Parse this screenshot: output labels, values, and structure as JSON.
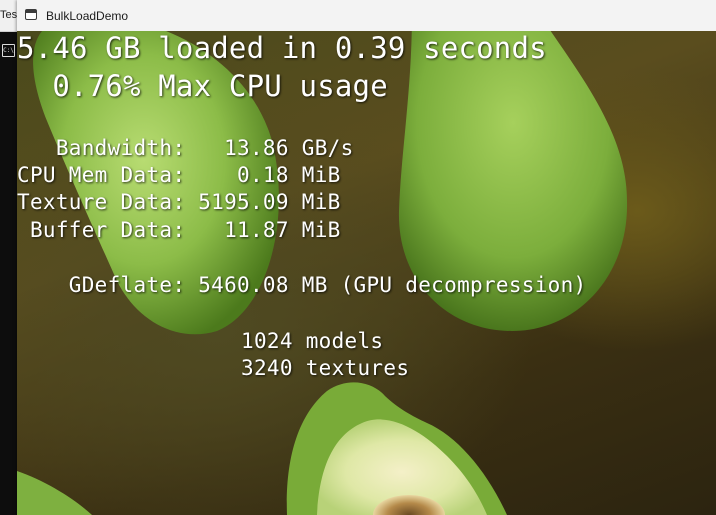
{
  "background_window": {
    "title_fragment": "Tes",
    "icon_name": "console-icon"
  },
  "window": {
    "title": "BulkLoadDemo",
    "icon_name": "app-window-icon"
  },
  "stats": {
    "headline_line1": "5.46 GB loaded in 0.39 seconds",
    "headline_line2": "  0.76% Max CPU usage",
    "rows": [
      {
        "label": "   Bandwidth:",
        "value": "   13.86 GB/s"
      },
      {
        "label": "CPU Mem Data:",
        "value": "    0.18 MiB"
      },
      {
        "label": "Texture Data:",
        "value": " 5195.09 MiB"
      },
      {
        "label": " Buffer Data:",
        "value": "   11.87 MiB"
      }
    ],
    "gdeflate_label": "    GDeflate:",
    "gdeflate_value": " 5460.08 MB (GPU decompression)",
    "models_count": "1024 models",
    "textures_count": "3240 textures"
  },
  "colors": {
    "text": "#ffffff",
    "fruit_light": "#a8d060",
    "fruit_dark": "#4f7a1e"
  }
}
